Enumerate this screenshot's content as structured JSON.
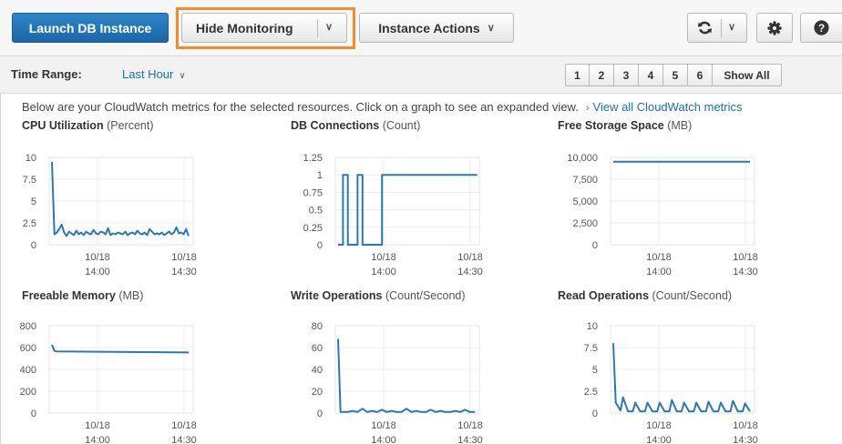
{
  "toolbar": {
    "launch_label": "Launch DB Instance",
    "hide_monitoring_label": "Hide Monitoring",
    "instance_actions_label": "Instance Actions",
    "refresh_icon": "refresh-icon",
    "gear_icon": "gear-icon",
    "help_icon": "help-icon",
    "caret": "∨"
  },
  "range": {
    "label": "Time Range:",
    "value": "Last Hour",
    "caret": "∨",
    "pages": [
      "1",
      "2",
      "3",
      "4",
      "5",
      "6"
    ],
    "show_all": "Show All"
  },
  "description": {
    "text": "Below are your CloudWatch metrics for the selected resources. Click on a graph to see an expanded view.",
    "arrow": "›",
    "link": "View all CloudWatch metrics"
  },
  "colors": {
    "line": "#2a78b5",
    "accent": "#1a6fb8",
    "highlight": "#f58b2a"
  },
  "chart_data": [
    {
      "type": "line",
      "title": "CPU Utilization",
      "unit": "(Percent)",
      "ylim": [
        0,
        10
      ],
      "yticks": [
        "10",
        "7.5",
        "5",
        "2.5",
        "0"
      ],
      "xticks": [
        {
          "date": "10/18",
          "time": "14:00"
        },
        {
          "date": "10/18",
          "time": "14:30"
        }
      ],
      "series": [
        {
          "x": [
            0,
            1,
            2,
            3,
            4,
            5,
            6,
            7,
            8,
            9,
            10,
            11,
            12,
            13,
            14,
            15,
            16,
            17,
            18,
            19,
            20,
            21,
            22,
            23,
            24,
            25,
            26,
            27,
            28,
            29,
            30,
            31,
            32,
            33,
            34,
            35,
            36,
            37,
            38,
            39,
            40,
            41,
            42,
            43,
            44,
            45,
            46,
            47,
            48,
            49,
            50,
            51,
            52,
            53,
            54,
            55,
            56
          ],
          "y": [
            9.5,
            1.2,
            1.4,
            1.8,
            2.3,
            1.4,
            1.0,
            1.5,
            1.3,
            1.1,
            1.6,
            1.2,
            1.4,
            1.1,
            1.5,
            1.3,
            1.2,
            1.7,
            1.3,
            1.2,
            1.5,
            1.4,
            1.2,
            1.9,
            1.1,
            1.3,
            1.2,
            1.4,
            1.3,
            1.2,
            1.5,
            1.1,
            1.3,
            1.4,
            1.2,
            1.6,
            1.3,
            1.2,
            1.4,
            1.1,
            1.8,
            1.5,
            1.2,
            1.3,
            1.2,
            1.4,
            1.1,
            1.3,
            1.5,
            1.2,
            1.4,
            2.0,
            1.3,
            1.4,
            1.2,
            1.8,
            1.0
          ]
        }
      ]
    },
    {
      "type": "line",
      "title": "DB Connections",
      "unit": "(Count)",
      "ylim": [
        0,
        1.25
      ],
      "yticks": [
        "1.25",
        "1",
        "0.75",
        "0.5",
        "0.25",
        "0"
      ],
      "xticks": [
        {
          "date": "10/18",
          "time": "14:00"
        },
        {
          "date": "10/18",
          "time": "14:30"
        }
      ],
      "series": [
        {
          "x": [
            0,
            2,
            2,
            4,
            4,
            8,
            8,
            10,
            10,
            18,
            18,
            57
          ],
          "y": [
            0,
            0,
            1,
            1,
            0,
            0,
            1,
            1,
            0,
            0,
            1,
            1
          ]
        }
      ]
    },
    {
      "type": "line",
      "title": "Free Storage Space",
      "unit": "(MB)",
      "ylim": [
        0,
        10000
      ],
      "yticks": [
        "10,000",
        "7,500",
        "5,000",
        "2,500",
        "0"
      ],
      "xticks": [
        {
          "date": "10/18",
          "time": "14:00"
        },
        {
          "date": "10/18",
          "time": "14:30"
        }
      ],
      "series": [
        {
          "x": [
            0,
            56
          ],
          "y": [
            9500,
            9500
          ]
        }
      ]
    },
    {
      "type": "line",
      "title": "Freeable Memory",
      "unit": "(MB)",
      "ylim": [
        0,
        800
      ],
      "yticks": [
        "800",
        "600",
        "400",
        "200",
        "0"
      ],
      "xticks": [
        {
          "date": "10/18",
          "time": "14:00"
        },
        {
          "date": "10/18",
          "time": "14:30"
        }
      ],
      "series": [
        {
          "x": [
            0,
            1,
            2,
            56
          ],
          "y": [
            625,
            570,
            565,
            555
          ]
        }
      ]
    },
    {
      "type": "line",
      "title": "Write Operations",
      "unit": "(Count/Second)",
      "ylim": [
        0,
        80
      ],
      "yticks": [
        "80",
        "60",
        "40",
        "20",
        "0"
      ],
      "xticks": [
        {
          "date": "10/18",
          "time": "14:00"
        },
        {
          "date": "10/18",
          "time": "14:30"
        }
      ],
      "series": [
        {
          "x": [
            0,
            1,
            4,
            6,
            8,
            10,
            12,
            14,
            16,
            18,
            20,
            22,
            24,
            26,
            28,
            30,
            32,
            34,
            36,
            38,
            40,
            42,
            44,
            46,
            48,
            50,
            52,
            54,
            56
          ],
          "y": [
            68,
            1,
            1,
            2,
            1,
            4,
            1,
            2,
            1,
            3,
            1,
            2,
            1,
            1,
            4,
            1,
            2,
            1,
            1,
            3,
            1,
            2,
            1,
            1,
            2,
            1,
            3,
            1,
            1
          ]
        }
      ]
    },
    {
      "type": "line",
      "title": "Read Operations",
      "unit": "(Count/Second)",
      "ylim": [
        0,
        10
      ],
      "yticks": [
        "10",
        "7.5",
        "5",
        "2.5",
        "0"
      ],
      "xticks": [
        {
          "date": "10/18",
          "time": "14:00"
        },
        {
          "date": "10/18",
          "time": "14:30"
        }
      ],
      "series": [
        {
          "x": [
            0,
            1,
            3,
            4,
            6,
            8,
            9,
            11,
            13,
            14,
            16,
            18,
            19,
            21,
            23,
            24,
            26,
            28,
            29,
            31,
            33,
            34,
            36,
            38,
            39,
            41,
            43,
            44,
            46,
            48,
            49,
            51,
            53,
            54,
            56
          ],
          "y": [
            8,
            1.2,
            0.3,
            1.8,
            0.2,
            0.2,
            1.2,
            0.2,
            0.2,
            1.2,
            0.2,
            0.2,
            1.2,
            0.2,
            0.2,
            1.5,
            0.2,
            0.2,
            1.2,
            0.2,
            0.2,
            1.2,
            0.2,
            0.2,
            1.3,
            0.2,
            0.2,
            1.2,
            0.2,
            0.2,
            1.4,
            0.2,
            0.2,
            1.1,
            0.2
          ]
        }
      ]
    }
  ]
}
